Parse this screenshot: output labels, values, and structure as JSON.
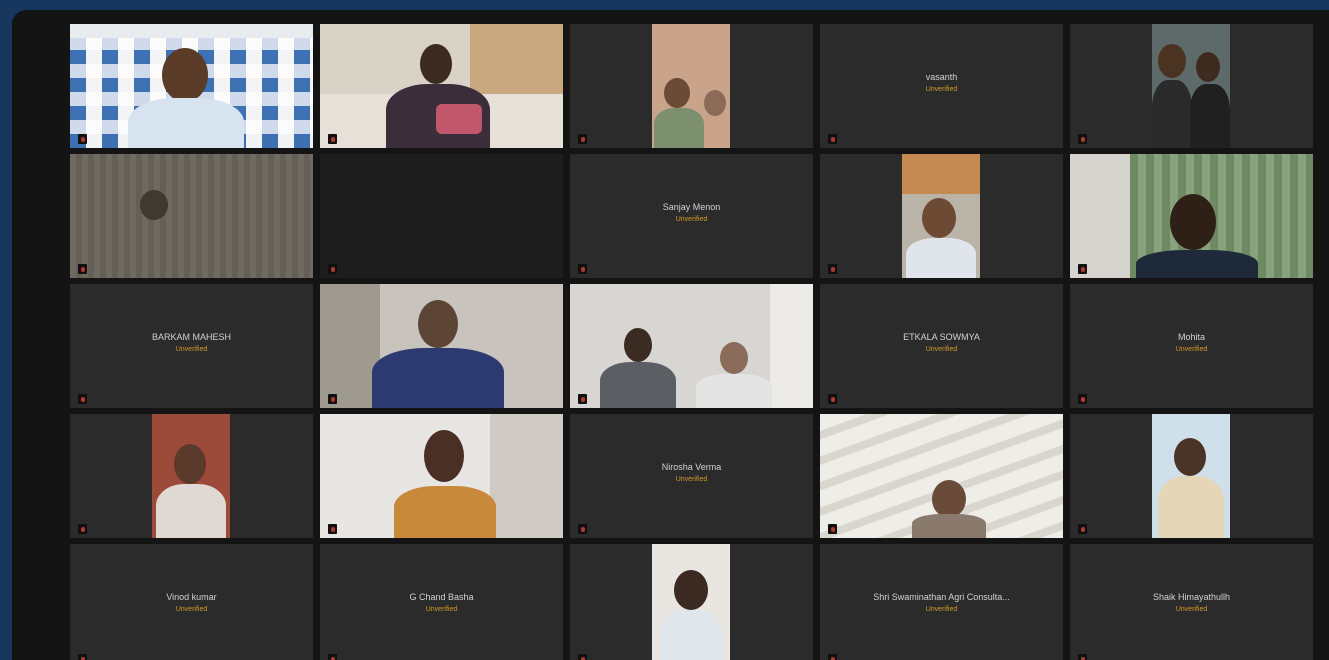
{
  "participants": [
    {
      "name": "",
      "status": "",
      "video": true
    },
    {
      "name": "",
      "status": "",
      "video": true
    },
    {
      "name": "",
      "status": "",
      "video": true
    },
    {
      "name": "vasanth",
      "status": "Unverified",
      "video": false
    },
    {
      "name": "",
      "status": "",
      "video": true
    },
    {
      "name": "",
      "status": "",
      "video": true
    },
    {
      "name": "",
      "status": "",
      "video": false
    },
    {
      "name": "Sanjay Menon",
      "status": "Unverified",
      "video": false
    },
    {
      "name": "",
      "status": "",
      "video": true
    },
    {
      "name": "",
      "status": "",
      "video": true
    },
    {
      "name": "BARKAM MAHESH",
      "status": "Unverified",
      "video": false
    },
    {
      "name": "",
      "status": "",
      "video": true
    },
    {
      "name": "",
      "status": "",
      "video": true
    },
    {
      "name": "ETKALA SOWMYA",
      "status": "Unverified",
      "video": false
    },
    {
      "name": "Mohita",
      "status": "Unverified",
      "video": false
    },
    {
      "name": "",
      "status": "",
      "video": true
    },
    {
      "name": "",
      "status": "",
      "video": true
    },
    {
      "name": "Nirosha Verma",
      "status": "Unverified",
      "video": false
    },
    {
      "name": "",
      "status": "",
      "video": true
    },
    {
      "name": "",
      "status": "",
      "video": true
    },
    {
      "name": "Vinod kumar",
      "status": "Unverified",
      "video": false
    },
    {
      "name": "G Chand Basha",
      "status": "Unverified",
      "video": false
    },
    {
      "name": "",
      "status": "",
      "video": true
    },
    {
      "name": "Shri Swaminathan Agri Consulta...",
      "status": "Unverified",
      "video": false
    },
    {
      "name": "Shaik Himayathullh",
      "status": "Unverified",
      "video": false
    }
  ],
  "icons": {
    "mic": "mic-muted-icon",
    "status": "unverified-icon"
  },
  "colors": {
    "tile": "#2b2b2b",
    "status": "#d39a2a",
    "mic_muted": "#b23a2e",
    "background": "#17375e"
  }
}
